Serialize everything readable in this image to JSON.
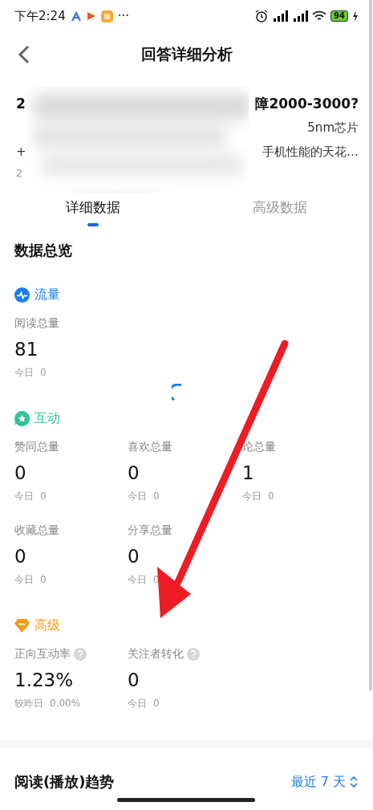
{
  "status_bar": {
    "time": "下午2:24",
    "more": "···",
    "battery": "94"
  },
  "header": {
    "title": "回答详细分析"
  },
  "answer": {
    "title_start": "2",
    "title_end": "障2000-3000?",
    "line1_end": "5nm芯片",
    "line2_start": "+",
    "line2_end": "手机性能的天花…",
    "date_start": "2"
  },
  "tabs": [
    {
      "label": "详细数据",
      "selected": true
    },
    {
      "label": "高级数据",
      "selected": false
    }
  ],
  "overview": {
    "title": "数据总览"
  },
  "sections": [
    {
      "kind": "traffic",
      "label": "流量",
      "color": "#1a7cf0",
      "metrics": [
        {
          "label": "阅读总量",
          "value": "81",
          "sub_label": "今日",
          "sub_value": "0",
          "help": false
        }
      ]
    },
    {
      "kind": "interaction",
      "label": "互动",
      "color": "#2fc49a",
      "metrics": [
        {
          "label": "赞同总量",
          "value": "0",
          "sub_label": "今日",
          "sub_value": "0",
          "help": false
        },
        {
          "label": "喜欢总量",
          "value": "0",
          "sub_label": "今日",
          "sub_value": "0",
          "help": false
        },
        {
          "label": "论总量",
          "value": "1",
          "sub_label": "今日",
          "sub_value": "0",
          "help": false
        },
        {
          "label": "收藏总量",
          "value": "0",
          "sub_label": "今日",
          "sub_value": "0",
          "help": false
        },
        {
          "label": "分享总量",
          "value": "0",
          "sub_label": "今日",
          "sub_value": "0",
          "help": false
        }
      ]
    },
    {
      "kind": "advanced",
      "label": "高级",
      "color": "#f59a12",
      "metrics": [
        {
          "label": "正向互动率",
          "value": "1.23%",
          "sub_label": "较昨日",
          "sub_value": "0.00%",
          "help": true
        },
        {
          "label": "关注者转化",
          "value": "0",
          "sub_label": "今日",
          "sub_value": "0",
          "help": true
        }
      ]
    }
  ],
  "trend": {
    "title": "阅读(播放)趋势",
    "range": "最近 7 天"
  }
}
